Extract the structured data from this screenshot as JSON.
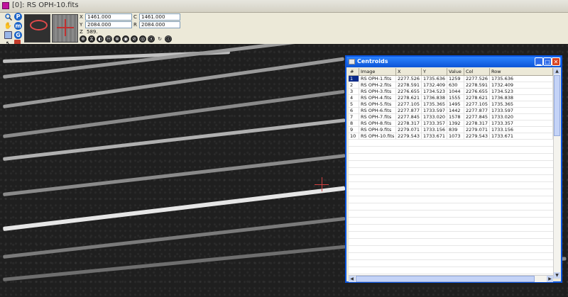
{
  "app": {
    "title": "[0]: RS OPH-10.fits"
  },
  "toolbar": {
    "tools": [
      {
        "icon": "zoom-icon",
        "label": "Q"
      },
      {
        "icon": "p-icon",
        "label": "P"
      },
      {
        "icon": "hand-icon",
        "label": "✋"
      },
      {
        "icon": "m-icon",
        "label": "m"
      },
      {
        "icon": "region-icon",
        "label": "▭"
      },
      {
        "icon": "g-icon",
        "label": "G"
      },
      {
        "icon": "pointer-icon",
        "label": "↖"
      },
      {
        "icon": "marker-icon",
        "label": "⇲"
      }
    ],
    "coords": {
      "x_label": "X",
      "x_value": "1461.000",
      "c_label": "C",
      "c_value": "1461.000",
      "y_label": "Y",
      "y_value": "2084.000",
      "r_label": "R",
      "r_value": "2084.000",
      "z_label": "Z",
      "z_value": "589."
    },
    "small_icons": [
      "⊕",
      "⧖",
      "◐",
      "ⓜ",
      "⊗",
      "◉",
      "⊘",
      "◎",
      "ⓐ",
      "↻",
      "ⓘ"
    ]
  },
  "centroids": {
    "title": "Centroids",
    "columns": [
      "#",
      "Image",
      "X",
      "Y",
      "Value",
      "Col",
      "Row"
    ],
    "rows": [
      [
        "1",
        "RS OPH-1.fits",
        "2277.526",
        "1735.636",
        "1259",
        "2277.526",
        "1735.636"
      ],
      [
        "2",
        "RS OPH-2.fits",
        "2278.591",
        "1732.409",
        "630",
        "2278.591",
        "1732.409"
      ],
      [
        "3",
        "RS OPH-3.fits",
        "2276.655",
        "1734.523",
        "1044",
        "2276.655",
        "1734.523"
      ],
      [
        "4",
        "RS OPH-4.fits",
        "2278.621",
        "1736.838",
        "1555",
        "2278.621",
        "1736.838"
      ],
      [
        "5",
        "RS OPH-5.fits",
        "2277.105",
        "1735.365",
        "1495",
        "2277.105",
        "1735.365"
      ],
      [
        "6",
        "RS OPH-6.fits",
        "2277.877",
        "1733.597",
        "1442",
        "2277.877",
        "1733.597"
      ],
      [
        "7",
        "RS OPH-7.fits",
        "2277.845",
        "1733.020",
        "1578",
        "2277.845",
        "1733.020"
      ],
      [
        "8",
        "RS OPH-8.fits",
        "2278.317",
        "1733.357",
        "1392",
        "2278.317",
        "1733.357"
      ],
      [
        "9",
        "RS OPH-9.fits",
        "2279.071",
        "1733.156",
        "839",
        "2279.071",
        "1733.156"
      ],
      [
        "10",
        "RS OPH-10.fits",
        "2279.543",
        "1733.671",
        "1073",
        "2279.543",
        "1733.671"
      ]
    ]
  }
}
